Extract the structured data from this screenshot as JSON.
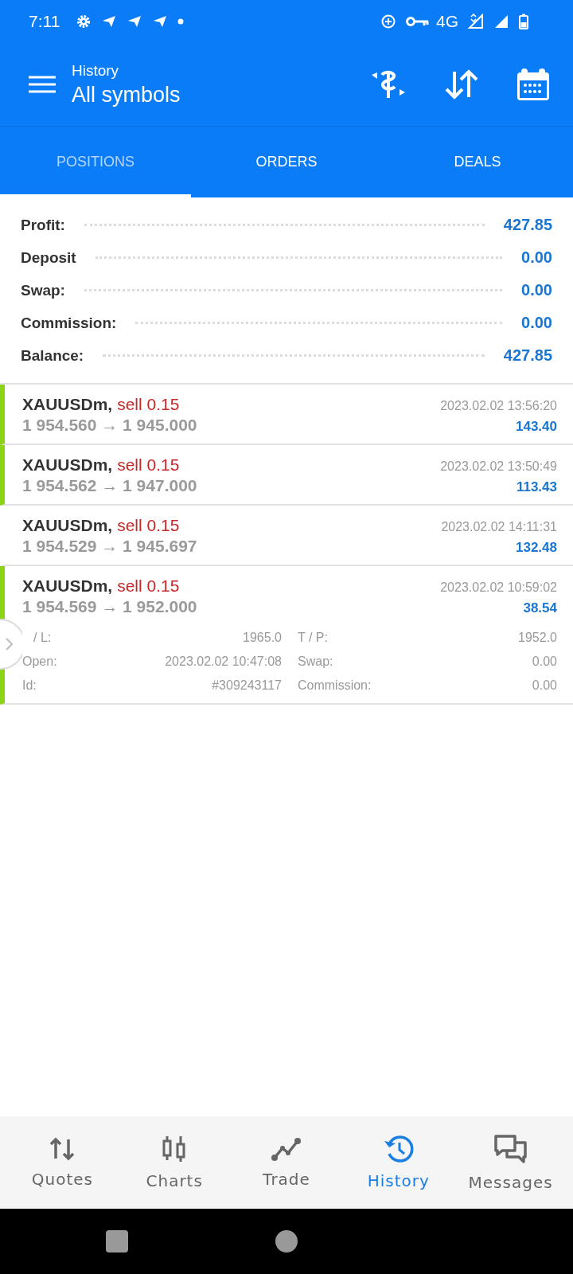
{
  "status_bar": {
    "time": "7:11",
    "network": "4G"
  },
  "app_bar": {
    "subtitle": "History",
    "title": "All symbols"
  },
  "tabs": [
    {
      "label": "POSITIONS",
      "selected": true
    },
    {
      "label": "ORDERS",
      "selected": false
    },
    {
      "label": "DEALS",
      "selected": false
    }
  ],
  "summary": [
    {
      "label": "Profit:",
      "value": "427.85"
    },
    {
      "label": "Deposit",
      "value": "0.00"
    },
    {
      "label": "Swap:",
      "value": "0.00"
    },
    {
      "label": "Commission:",
      "value": "0.00"
    },
    {
      "label": "Balance:",
      "value": "427.85"
    }
  ],
  "positions": [
    {
      "symbol": "XAUUSDm,",
      "trade": "sell 0.15",
      "prices": "1 954.560 → 1 945.000",
      "time": "2023.02.02 13:56:20",
      "profit": "143.40",
      "marked": true,
      "expanded": false
    },
    {
      "symbol": "XAUUSDm,",
      "trade": "sell 0.15",
      "prices": "1 954.562 → 1 947.000",
      "time": "2023.02.02 13:50:49",
      "profit": "113.43",
      "marked": true,
      "expanded": false
    },
    {
      "symbol": "XAUUSDm,",
      "trade": "sell 0.15",
      "prices": "1 954.529 → 1 945.697",
      "time": "2023.02.02 14:11:31",
      "profit": "132.48",
      "marked": false,
      "expanded": false
    },
    {
      "symbol": "XAUUSDm,",
      "trade": "sell 0.15",
      "prices": "1 954.569 → 1 952.000",
      "time": "2023.02.02 10:59:02",
      "profit": "38.54",
      "marked": true,
      "expanded": true,
      "details": [
        {
          "label": "/ L:",
          "value": "1965.0",
          "label_2": "T / P:",
          "value_2": "1952.0"
        },
        {
          "label": "Open:",
          "value": "2023.02.02 10:47:08",
          "label_2": "Swap:",
          "value_2": "0.00"
        },
        {
          "label": "Id:",
          "value": "#309243117",
          "label_2": "Commission:",
          "value_2": "0.00"
        }
      ]
    }
  ],
  "bottom_nav": [
    {
      "label": "Quotes",
      "selected": false
    },
    {
      "label": "Charts",
      "selected": false
    },
    {
      "label": "Trade",
      "selected": false
    },
    {
      "label": "History",
      "selected": true
    },
    {
      "label": "Messages",
      "selected": false
    }
  ]
}
